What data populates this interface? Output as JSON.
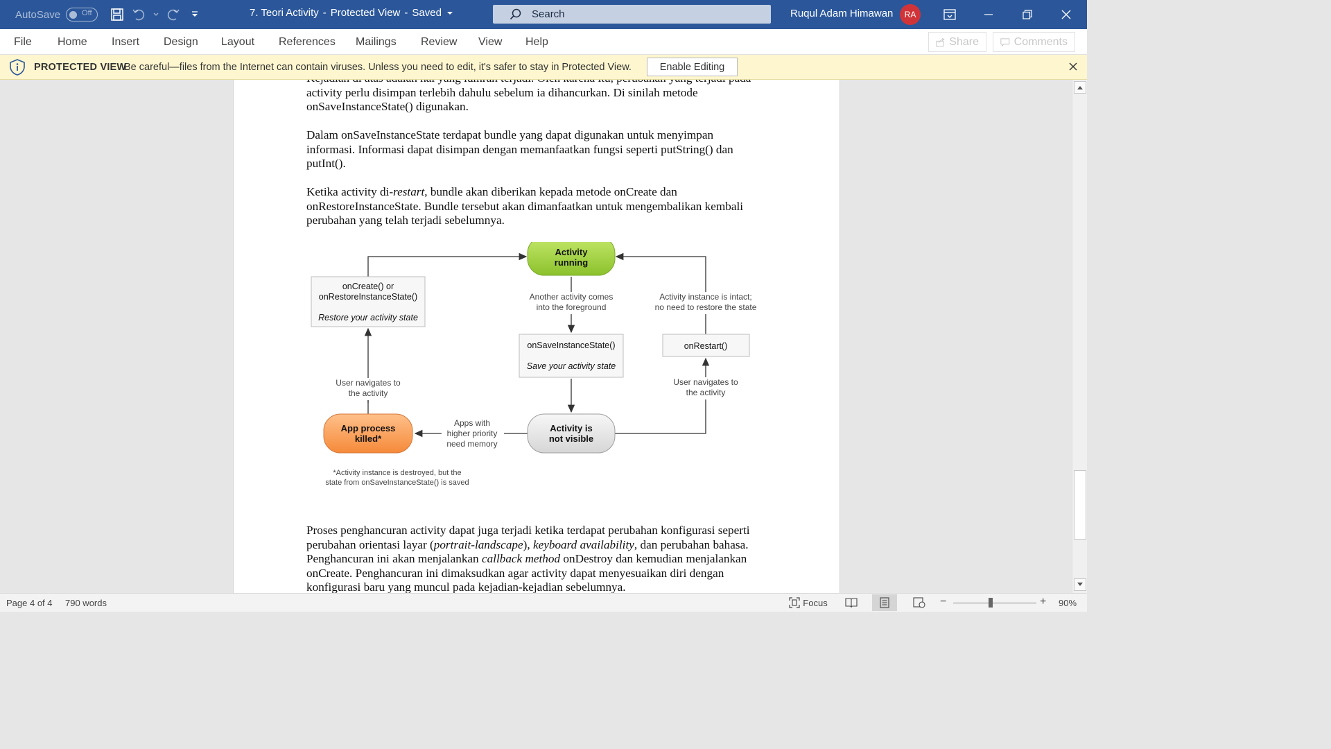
{
  "titlebar": {
    "autosave_label": "AutoSave",
    "autosave_state": "Off",
    "doc_title": "7. Teori Activity",
    "doc_separator": "-",
    "doc_mode": "Protected View",
    "doc_sep2": "-",
    "doc_status": "Saved",
    "search_placeholder": "Search",
    "user_name": "Ruqul Adam Himawan",
    "user_initials": "RA"
  },
  "ribbon": {
    "tabs": [
      "File",
      "Home",
      "Insert",
      "Design",
      "Layout",
      "References",
      "Mailings",
      "Review",
      "View",
      "Help"
    ],
    "share_label": "Share",
    "comments_label": "Comments"
  },
  "protected_bar": {
    "title": "PROTECTED VIEW",
    "message": "Be careful—files from the Internet can contain viruses. Unless you need to edit, it's safer to stay in Protected View.",
    "enable_label": "Enable Editing"
  },
  "document": {
    "para0_line1": "Kejadian di atas adalah hal yang lumrah terjadi. Oleh karena itu, perubahan yang terjadi pada",
    "para0_line2": "activity perlu disimpan terlebih dahulu sebelum ia dihancurkan. Di sinilah metode",
    "para0_line3": "onSaveInstanceState() digunakan.",
    "para1_line1": "Dalam onSaveInstanceState terdapat bundle yang dapat digunakan untuk menyimpan",
    "para1_line2": "informasi. Informasi dapat disimpan dengan memanfaatkan fungsi seperti putString() dan",
    "para1_line3": "putInt().",
    "para2_line1a": "Ketika activity di-",
    "para2_line1b": "restart",
    "para2_line1c": ", bundle akan diberikan kepada metode onCreate dan",
    "para2_line2": "onRestoreInstanceState. Bundle tersebut akan dimanfaatkan untuk mengembalikan kembali",
    "para2_line3": "perubahan yang telah terjadi sebelumnya.",
    "para3_line1": "Proses penghancuran activity dapat juga terjadi ketika terdapat perubahan konfigurasi seperti",
    "para3_line2a": "perubahan orientasi layar (",
    "para3_line2b": "portrait-landscape",
    "para3_line2c": "), ",
    "para3_line2d": "keyboard availability",
    "para3_line2e": ", dan perubahan bahasa.",
    "para3_line3a": "Penghancuran ini akan menjalankan ",
    "para3_line3b": "callback method",
    "para3_line3c": " onDestroy dan kemudian menjalankan",
    "para3_line4": "onCreate. Penghancuran ini dimaksudkan agar activity dapat menyesuaikan diri dengan",
    "para3_line5": "konfigurasi baru yang muncul pada kejadian-kejadian sebelumnya."
  },
  "diagram": {
    "running_l1": "Activity",
    "running_l2": "running",
    "oncreate_l1": "onCreate() or",
    "oncreate_l2": "onRestoreInstanceState()",
    "oncreate_l3": "Restore your activity state",
    "another_l1": "Another activity comes",
    "another_l2": "into the foreground",
    "intact_l1": "Activity instance is intact;",
    "intact_l2": "no need to restore the state",
    "onsave_l1": "onSaveInstanceState()",
    "onsave_l2": "Save your activity state",
    "onrestart_l1": "onRestart()",
    "nav_left_l1": "User navigates to",
    "nav_left_l2": "the activity",
    "nav_right_l1": "User navigates to",
    "nav_right_l2": "the activity",
    "killed_l1": "App process",
    "killed_l2": "killed*",
    "apps_l1": "Apps with",
    "apps_l2": "higher priority",
    "apps_l3": "need memory",
    "notvisible_l1": "Activity is",
    "notvisible_l2": "not visible",
    "footnote_l1": "*Activity instance is destroyed, but the",
    "footnote_l2": "state from onSaveInstanceState() is saved"
  },
  "statusbar": {
    "page": "Page 4 of 4",
    "words": "790 words",
    "focus": "Focus",
    "zoom": "90%",
    "zoom_minus": "−",
    "zoom_plus": "+"
  },
  "colors": {
    "titlebar": "#2b579a",
    "protected_bar": "#fdf6cf",
    "running_node": "#9ccc3b",
    "killed_node": "#f79a55",
    "notvisible_node": "#e6e6e6"
  }
}
